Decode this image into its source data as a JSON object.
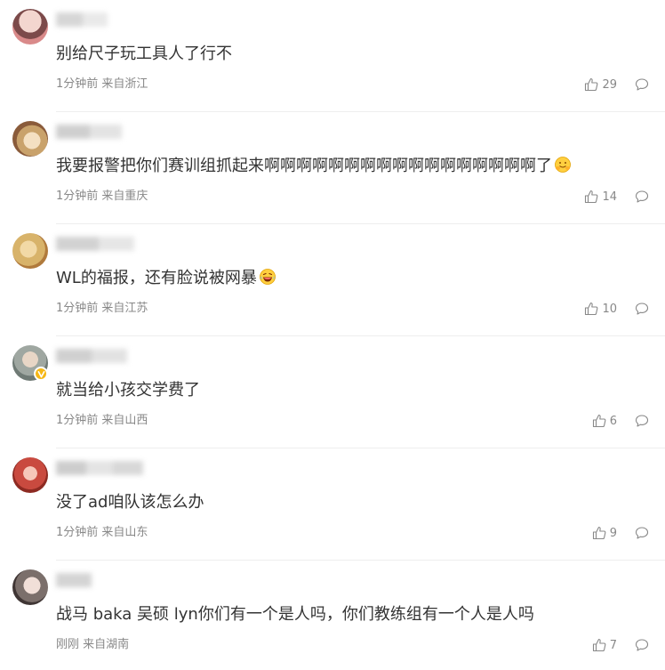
{
  "comments": [
    {
      "text": "别给尺子玩工具人了行不",
      "time": "1分钟前",
      "location": "来自浙江",
      "likes": "29",
      "avatar_color": "#d98a8a",
      "emoji": null,
      "verified": false
    },
    {
      "text": "我要报警把你们赛训组抓起来啊啊啊啊啊啊啊啊啊啊啊啊啊啊啊啊啊了",
      "time": "1分钟前",
      "location": "来自重庆",
      "likes": "14",
      "avatar_color": "#c9a26b",
      "emoji": "hug-emoji",
      "verified": false
    },
    {
      "text": "WL的福报，还有脸说被网暴",
      "time": "1分钟前",
      "location": "来自江苏",
      "likes": "10",
      "avatar_color": "#d8b36a",
      "emoji": "laugh-cry-emoji",
      "verified": false
    },
    {
      "text": "就当给小孩交学费了",
      "time": "1分钟前",
      "location": "来自山西",
      "likes": "6",
      "avatar_color": "#9fa7a1",
      "emoji": null,
      "verified": true
    },
    {
      "text": "没了ad咱队该怎么办",
      "time": "1分钟前",
      "location": "来自山东",
      "likes": "9",
      "avatar_color": "#c94a3f",
      "emoji": null,
      "verified": false
    },
    {
      "text": "战马 baka 吴硕 lyn你们有一个是人吗，你们教练组有一个人是人吗",
      "time": "刚刚",
      "location": "来自湖南",
      "likes": "7",
      "avatar_color": "#7b6f6b",
      "emoji": null,
      "verified": false
    }
  ],
  "icons": {
    "like": "thumbs-up-icon",
    "reply": "comment-bubble-icon",
    "verified": "verified-v-icon"
  },
  "colors": {
    "meta_text": "#888888",
    "body_text": "#333333",
    "badge": "#f5b716",
    "divider": "#eeeeee"
  }
}
